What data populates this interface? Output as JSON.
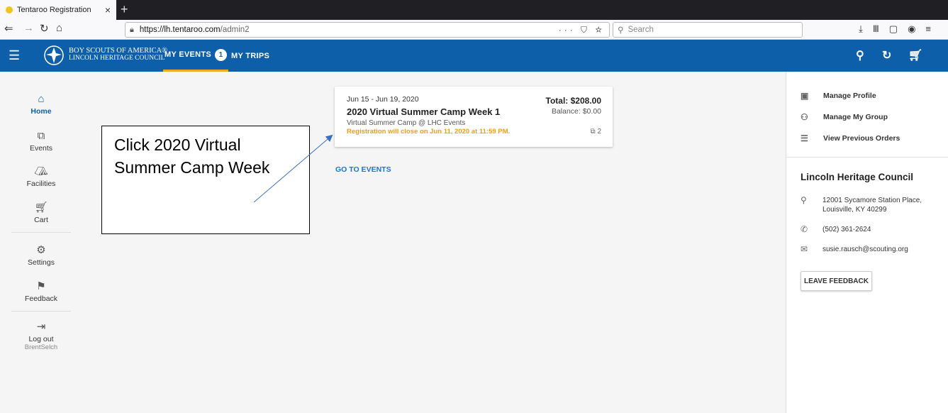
{
  "browser": {
    "tab_title": "Tentaroo Registration",
    "tab_close": "×",
    "new_tab": "+",
    "url_host": "https://lh.tentaroo.com",
    "url_path": "/admin2",
    "url_actions": "··· ⛉ ☆",
    "search_placeholder": "Search"
  },
  "header": {
    "brand_line1": "BOY SCOUTS OF AMERICA®",
    "brand_line2": "LINCOLN HERITAGE COUNCIL",
    "tabs": [
      {
        "label": "MY EVENTS",
        "badge": "1"
      },
      {
        "label": "MY TRIPS"
      }
    ],
    "accent": "#0c5fa8",
    "active_underline": "#f5a623"
  },
  "sidebar": {
    "items": [
      {
        "label": "Home",
        "icon": "home-icon"
      },
      {
        "label": "Events",
        "icon": "tickets-icon"
      },
      {
        "label": "Facilities",
        "icon": "tent-icon"
      },
      {
        "label": "Cart",
        "icon": "cart-icon"
      },
      {
        "label": "Settings",
        "icon": "gear-icon"
      },
      {
        "label": "Feedback",
        "icon": "feedback-icon"
      },
      {
        "label": "Log out",
        "icon": "logout-icon",
        "sub": "BrentSelch"
      }
    ]
  },
  "event_card": {
    "dates": "Jun 15 - Jun 19, 2020",
    "title": "2020 Virtual Summer Camp Week 1",
    "subtitle": "Virtual Summer Camp @ LHC Events",
    "warning": "Registration will close on Jun 11, 2020 at 11:59 PM.",
    "total": "Total: $208.00",
    "balance": "Balance: $0.00",
    "ticket_count": "2",
    "warning_color": "#f39c12"
  },
  "go_to_events": "GO TO EVENTS",
  "annotation": {
    "text": "Click 2020 Virtual Summer Camp Week"
  },
  "right_panel": {
    "links": [
      {
        "label": "Manage Profile",
        "icon": "profile-icon"
      },
      {
        "label": "Manage My Group",
        "icon": "group-icon"
      },
      {
        "label": "View Previous Orders",
        "icon": "list-icon"
      }
    ],
    "org_name": "Lincoln Heritage Council",
    "address_line1": "12001 Sycamore Station Place,",
    "address_line2": "Louisville, KY 40299",
    "phone": "(502) 361-2624",
    "email": "susie.rausch@scouting.org",
    "feedback_button": "LEAVE FEEDBACK"
  }
}
